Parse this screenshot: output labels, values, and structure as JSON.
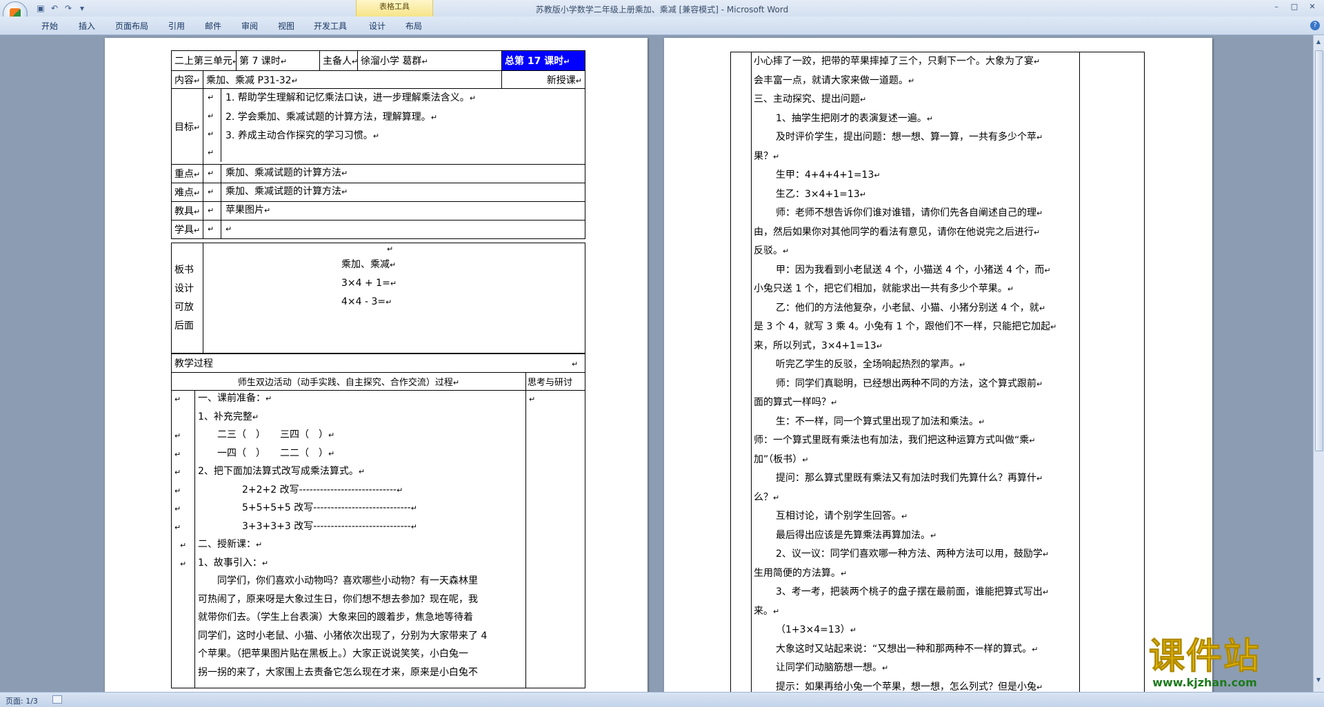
{
  "window": {
    "title": "苏教版小学数学二年级上册乘加、乘减 [兼容模式]",
    "app": " - Microsoft Word",
    "context_tab": "表格工具"
  },
  "ribbon": {
    "tabs": [
      "开始",
      "插入",
      "页面布局",
      "引用",
      "邮件",
      "审阅",
      "视图",
      "开发工具",
      "设计",
      "布局"
    ]
  },
  "status": {
    "page": "页面: 1/3"
  },
  "watermark": {
    "title": "课件站",
    "url": "www.kjzhan.com"
  },
  "mark": "↵",
  "page1": {
    "header": {
      "unit": "二上第三单元",
      "lesson": "第 7 课时",
      "preparer_label": "主备人",
      "preparer": "徐溜小学 葛群",
      "total": "总第 17 课时"
    },
    "content_label": "内容",
    "content": "乘加、乘减 P31-32",
    "lesson_type": "新授课",
    "goals_label": "目标",
    "goals": [
      "1. 帮助学生理解和记忆乘法口诀，进一步理解乘法含义。",
      "2. 学会乘加、乘减试题的计算方法，理解算理。",
      "3. 养成主动合作探究的学习习惯。"
    ],
    "key_label": "重点",
    "key": "乘加、乘减试题的计算方法",
    "diff_label": "难点",
    "diff": "乘加、乘减试题的计算方法",
    "tools_label": "教具",
    "tools": "苹果图片",
    "student_tools_label": "学具",
    "board_label": [
      "板书",
      "设计",
      "可放",
      "后面"
    ],
    "board": [
      "乘加、乘减",
      "3×4 + 1=",
      "4×4 - 3="
    ],
    "process_label": "教学过程",
    "activity_header": "师生双边活动（动手实践、自主探究、合作交流）过程",
    "think_header": "思考与研讨",
    "lines": [
      {
        "t": "一、课前准备：",
        "i": 0
      },
      {
        "t": "1、补充完整",
        "i": 0
      },
      {
        "t": "二三（　）　　三四（　）",
        "i": 1
      },
      {
        "t": "一四（　）　　二二（　）",
        "i": 1
      },
      {
        "t": "2、把下面加法算式改写成乘法算式。",
        "i": 0
      },
      {
        "t": "2+2+2 改写----------------------------",
        "i": 2
      },
      {
        "t": "5+5+5+5 改写----------------------------",
        "i": 2
      },
      {
        "t": "3+3+3+3 改写----------------------------",
        "i": 2
      },
      {
        "t": "二、授新课：",
        "i": 0
      },
      {
        "t": "1、故事引入：",
        "i": 0
      }
    ],
    "story": [
      "同学们，你们喜欢小动物吗？喜欢哪些小动物？有一天森林里",
      "可热闹了，原来呀是大象过生日，你们想不想去参加？现在呢，我",
      "就带你们去。（学生上台表演）大象来回的踱着步，焦急地等待着",
      "同学们，这时小老鼠、小猫、小猪依次出现了，分别为大家带来了 4",
      "个苹果。（把苹果图片贴在黑板上。）大家正说说笑笑，小白兔一",
      "拐一拐的来了，大家围上去责备它怎么现在才来，原来是小白兔不"
    ]
  },
  "page2": {
    "lines": [
      {
        "t": "小心摔了一跤，把带的苹果摔掉了三个，只剩下一个。大象为了宴",
        "p": 0
      },
      {
        "t": "会丰富一点，就请大家来做一道题。",
        "p": 0
      },
      {
        "t": "三、主动探究、提出问题",
        "p": 0
      },
      {
        "t": "1、抽学生把刚才的表演复述一遍。",
        "p": 1
      },
      {
        "t": "及时评价学生，提出问题：想一想、算一算，一共有多少个苹",
        "p": 1
      },
      {
        "t": "果？",
        "p": 0
      },
      {
        "t": "生甲：4+4+4+1=13",
        "p": 1
      },
      {
        "t": "生乙：3×4+1=13",
        "p": 1
      },
      {
        "t": "师：老师不想告诉你们谁对谁错，请你们先各自阐述自己的理",
        "p": 1
      },
      {
        "t": "由，然后如果你对其他同学的看法有意见，请你在他说完之后进行",
        "p": 0
      },
      {
        "t": "反驳。",
        "p": 0
      },
      {
        "t": "甲：因为我看到小老鼠送 4 个，小猫送 4 个，小猪送 4 个，而",
        "p": 1
      },
      {
        "t": "小兔只送 1 个，把它们相加，就能求出一共有多少个苹果。",
        "p": 0
      },
      {
        "t": "乙：他们的方法他复杂，小老鼠、小猫、小猪分别送 4 个，就",
        "p": 1
      },
      {
        "t": "是 3 个 4，就写 3 乘 4。小兔有 1 个，跟他们不一样，只能把它加起",
        "p": 0
      },
      {
        "t": "来，所以列式，3×4+1=13",
        "p": 0
      },
      {
        "t": "听完乙学生的反驳，全场响起热烈的掌声。",
        "p": 1
      },
      {
        "t": "师：同学们真聪明，已经想出两种不同的方法，这个算式跟前",
        "p": 1
      },
      {
        "t": "面的算式一样吗？",
        "p": 0
      },
      {
        "t": "生：不一样，同一个算式里出现了加法和乘法。",
        "p": 1
      },
      {
        "t": "师：一个算式里既有乘法也有加法，我们把这种运算方式叫做“乘",
        "p": 0
      },
      {
        "t": "加”（板书）",
        "p": 0
      },
      {
        "t": "提问：那么算式里既有乘法又有加法时我们先算什么？再算什",
        "p": 1
      },
      {
        "t": "么？",
        "p": 0
      },
      {
        "t": "互相讨论，请个别学生回答。",
        "p": 1
      },
      {
        "t": "最后得出应该是先算乘法再算加法。",
        "p": 1
      },
      {
        "t": "2、议一议：同学们喜欢哪一种方法、两种方法可以用，鼓励学",
        "p": 1
      },
      {
        "t": "生用简便的方法算。",
        "p": 0
      },
      {
        "t": "3、考一考，把装两个桃子的盘子摆在最前面，谁能把算式写出",
        "p": 1
      },
      {
        "t": "来。",
        "p": 0
      },
      {
        "t": "（1+3×4=13）",
        "p": 1
      },
      {
        "t": "大象这时又站起来说：“又想出一种和那两种不一样的算式。",
        "p": 1
      },
      {
        "t": "让同学们动脑筋想一想。",
        "p": 1
      },
      {
        "t": "提示：如果再给小兔一个苹果，想一想，怎么列式？但是小兔",
        "p": 1
      }
    ]
  }
}
